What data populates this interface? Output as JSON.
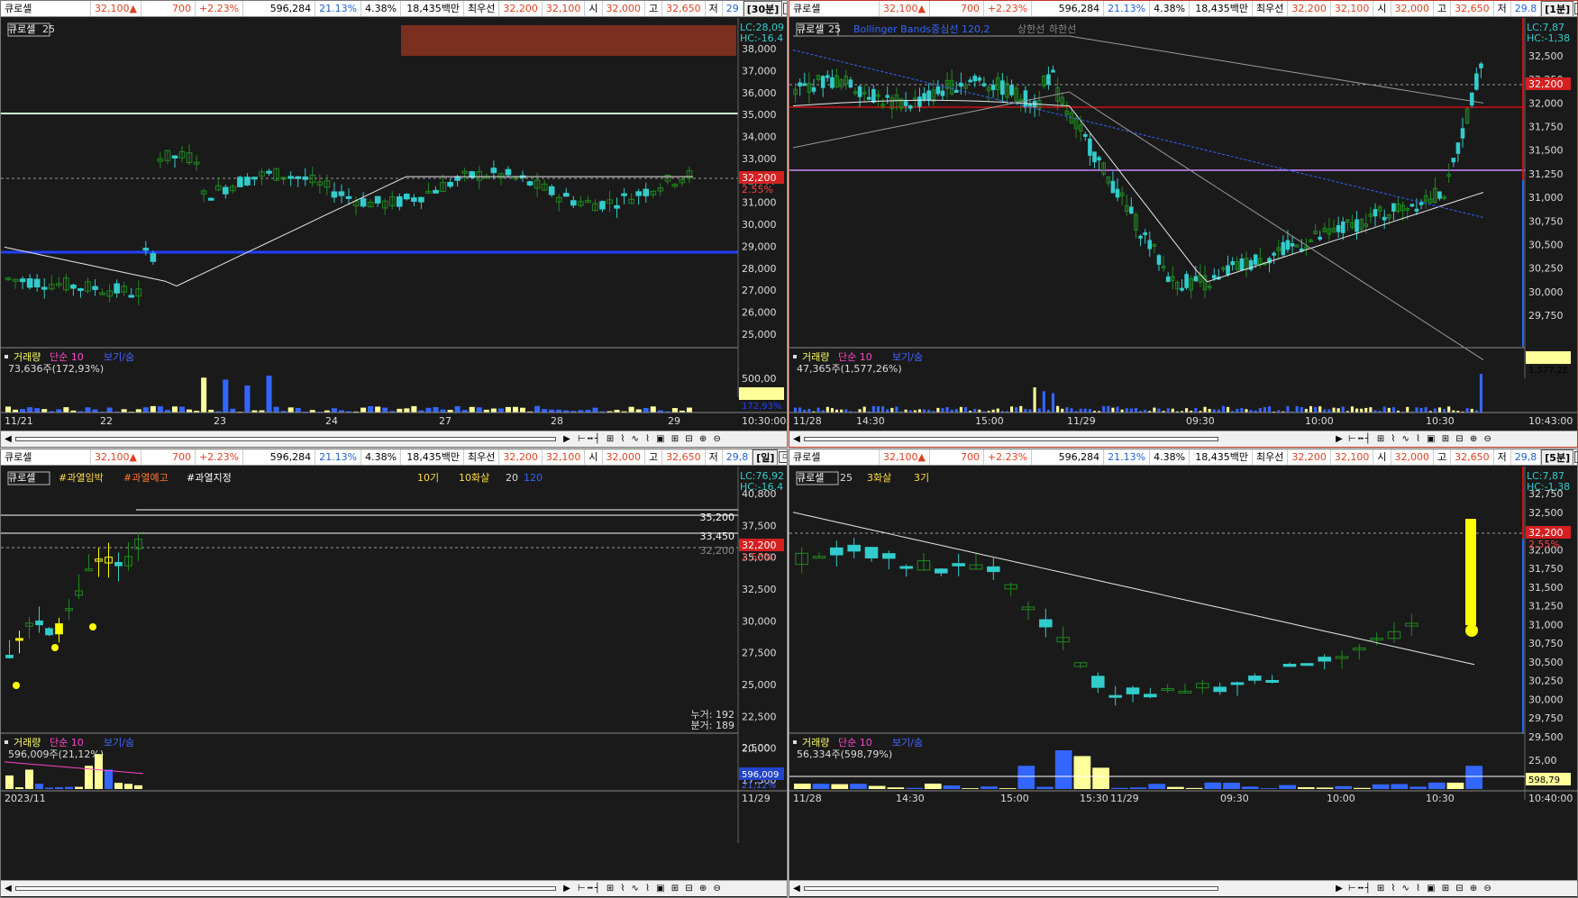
{
  "ticker": {
    "name": "큐로셀",
    "price": "32,100▲",
    "change": "700",
    "change_pct": "+2.23%",
    "volume": "596,284",
    "turnover_pct": "21.13%",
    "pct2": "4.38%",
    "amount": "18,435백만",
    "bid_label": "최우선",
    "ask_price": "32,200",
    "bid_price": "32,100",
    "open_label": "시",
    "open": "32,000",
    "high_label": "고",
    "high": "32,650",
    "low_label": "저",
    "low_partial_a": "29",
    "low_partial_b": "29,8",
    "low_partial_c": "29.8"
  },
  "panels": {
    "p1": {
      "timeframe": "[30분]",
      "legend": [
        "큐로셀",
        "25"
      ],
      "lc": "LC:28,09",
      "hc": "HC:-16.4",
      "price_axis": [
        "38,000",
        "37,000",
        "36,000",
        "35,000",
        "34,000",
        "33,000",
        "32,000",
        "31,000",
        "30,000",
        "29,000",
        "28,000",
        "27,000",
        "26,000",
        "25,000"
      ],
      "current_price": "32,200",
      "current_pct": "2.55%",
      "vol_legend": [
        "거래량",
        "단순 10",
        "보기/숨"
      ],
      "vol_value": "73,636주(172,93%)",
      "vol_axis": [
        "500,00"
      ],
      "vol_tag": "172,93%",
      "dates": [
        "11/21",
        "22",
        "23",
        "24",
        "27",
        "28",
        "29"
      ],
      "time": "10:30:00"
    },
    "p2": {
      "timeframe": "[1분]",
      "legend": [
        "큐로셀",
        "25",
        "Bollinger Bands중심선 120,2",
        "상한선",
        "하한선"
      ],
      "lc": "LC:7,87",
      "hc": "HC:-1,38",
      "price_axis": [
        "32,500",
        "32,250",
        "32,000",
        "31,750",
        "31,500",
        "31,250",
        "31,000",
        "30,750",
        "30,500",
        "30,250",
        "30,000",
        "29,750"
      ],
      "current_price": "32,200",
      "current_pct": "2.55%",
      "vol_legend": [
        "거래량",
        "단순 10",
        "보기/숨"
      ],
      "vol_value": "47,365주(1,577,26%)",
      "vol_tag": "1,577,2E",
      "dates": [
        "11/28",
        "14:30",
        "15:00",
        "11/29",
        "09:30",
        "10:00",
        "10:30"
      ],
      "time": "10:43:00"
    },
    "p3": {
      "timeframe": "[일]",
      "legend": [
        "큐로셀",
        "#과열임박",
        "#과열예고",
        "#과열지정",
        "10기",
        "10화살",
        "20",
        "120"
      ],
      "lc": "LC:76,92",
      "hc": "HC:-16.4",
      "price_axis": [
        "40,800",
        "37,500",
        "35,000",
        "32,500",
        "30,000",
        "27,500",
        "25,000",
        "22,500",
        "20,000",
        "17,500"
      ],
      "level_labels": [
        "35,200",
        "33,450",
        "32,200"
      ],
      "current_price": "32,200",
      "current_pct": "2.55%",
      "stats": [
        "누거: 192",
        "분거: 189"
      ],
      "vol_legend": [
        "거래량",
        "단순 10",
        "보기/숨"
      ],
      "vol_value": "596,009주(21,12%)",
      "vol_axis": [
        "2,500"
      ],
      "vol_tag": "596,009",
      "vol_tag2": "21,12%",
      "dates": [
        "2023/11"
      ],
      "time": "11/29"
    },
    "p4": {
      "timeframe": "[5분]",
      "legend": [
        "큐로셀",
        "25",
        "3화살",
        "3기"
      ],
      "lc": "LC:7,87",
      "hc": "HC:-1,38",
      "price_axis": [
        "32,750",
        "32,500",
        "32,250",
        "32,000",
        "31,750",
        "31,500",
        "31,250",
        "31,000",
        "30,750",
        "30,500",
        "30,250",
        "30,000",
        "29,750",
        "29,500"
      ],
      "current_price": "32,200",
      "current_pct": "2.55%",
      "vol_legend": [
        "거래량",
        "단순 10",
        "보기/숨"
      ],
      "vol_value": "56,334주(598,79%)",
      "vol_axis": [
        "25,00"
      ],
      "vol_tag": "598,79",
      "dates": [
        "11/28",
        "14:30",
        "15:00",
        "15:30",
        "11/29",
        "09:30",
        "10:00",
        "10:30"
      ],
      "time": "10:40:00"
    }
  },
  "colors": {
    "up": "#1f8a1f",
    "down": "#33cccc",
    "hot": "#ffff00",
    "ma": "#e8e8e8",
    "blue": "#2040ff",
    "price_tag": "#d42020"
  }
}
